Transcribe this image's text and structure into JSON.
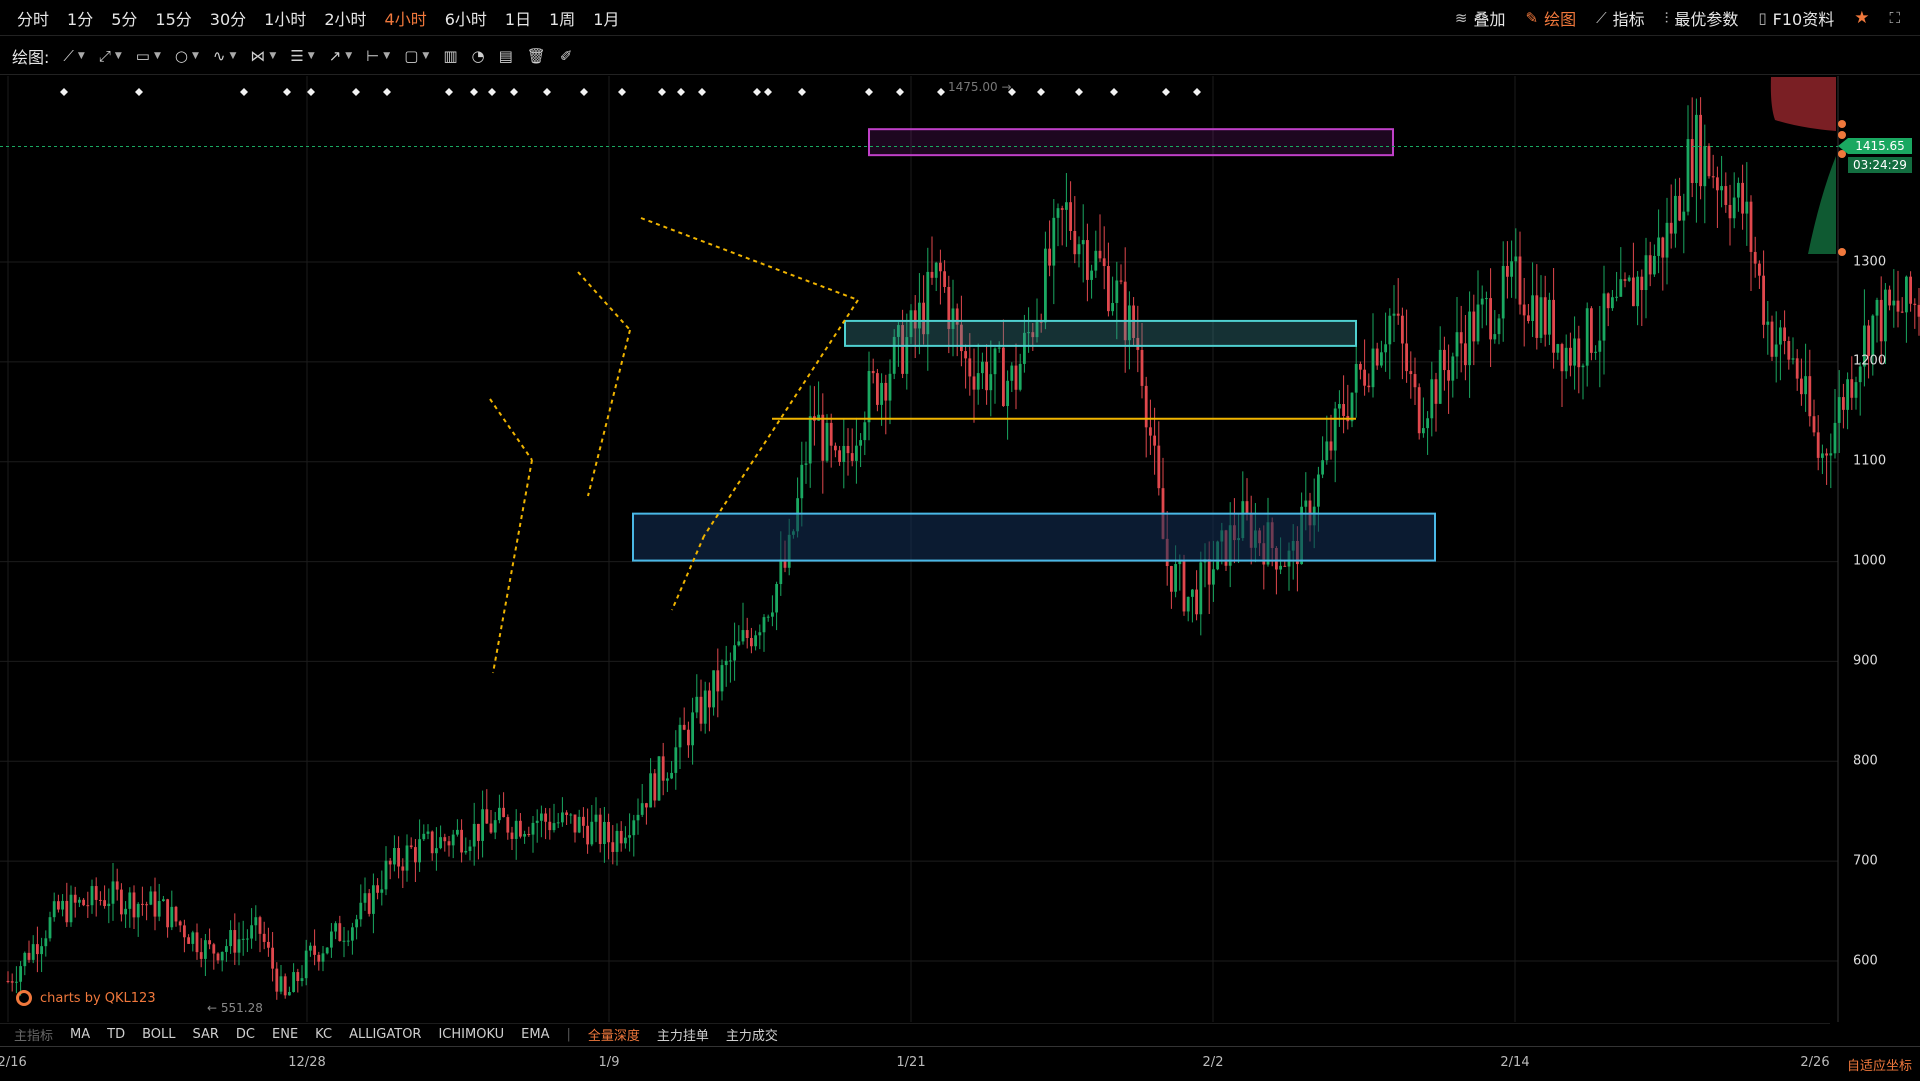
{
  "timeframes": [
    {
      "label": "分时",
      "active": false
    },
    {
      "label": "1分",
      "active": false
    },
    {
      "label": "5分",
      "active": false
    },
    {
      "label": "15分",
      "active": false
    },
    {
      "label": "30分",
      "active": false
    },
    {
      "label": "1小时",
      "active": false
    },
    {
      "label": "2小时",
      "active": false
    },
    {
      "label": "4小时",
      "active": true
    },
    {
      "label": "6小时",
      "active": false
    },
    {
      "label": "1日",
      "active": false
    },
    {
      "label": "1周",
      "active": false
    },
    {
      "label": "1月",
      "active": false
    }
  ],
  "right_tools": {
    "overlay": "叠加",
    "draw": "绘图",
    "indicators": "指标",
    "best_params": "最优参数",
    "f10": "F10资料"
  },
  "draw_toolbar": {
    "label": "绘图:"
  },
  "indicator_bar": {
    "main_indicator": "主指标",
    "items": [
      "MA",
      "TD",
      "BOLL",
      "SAR",
      "DC",
      "ENE",
      "KC",
      "ALLIGATOR",
      "ICHIMOKU",
      "EMA"
    ],
    "depth_items": [
      "全量深度",
      "主力挂单",
      "主力成交"
    ]
  },
  "dates": [
    "12/16",
    "12/28",
    "1/9",
    "1/21",
    "2/2",
    "2/14",
    "2/26"
  ],
  "autoscale_label": "自适应坐标",
  "yaxis": [
    "1300",
    "1200",
    "1100",
    "1000",
    "900",
    "800",
    "700",
    "600"
  ],
  "current_price": "1415.65",
  "countdown": "03:24:29",
  "max_label": "1475.00",
  "min_label": "551.28",
  "brand": "charts by QKL123",
  "colors": {
    "up": "#1aa861",
    "down": "#e0484d",
    "accent": "#f0783c",
    "grid": "#1c1c1c",
    "zone_purple": "#c040c8",
    "zone_teal": "#4fd0d0",
    "zone_blue": "#4ab8e6",
    "trend_dots": "#f0b400"
  },
  "chart_data": {
    "type": "candlestick",
    "title": "",
    "xlabel": "",
    "ylabel": "",
    "ylim": [
      510,
      1555
    ],
    "x_ticks": [
      "12/16",
      "12/28",
      "1/9",
      "1/21",
      "2/2",
      "2/14",
      "2/26"
    ],
    "y_ticks": [
      600,
      700,
      800,
      900,
      1000,
      1100,
      1200,
      1300
    ],
    "current_price": 1415.65,
    "high_marker": 1475.0,
    "low_marker": 551.28,
    "price_path": [
      [
        12.16,
        580
      ],
      [
        12.18,
        650
      ],
      [
        12.2,
        665
      ],
      [
        12.22,
        655
      ],
      [
        12.24,
        610
      ],
      [
        12.26,
        630
      ],
      [
        12.27,
        560
      ],
      [
        12.28,
        605
      ],
      [
        12.3,
        645
      ],
      [
        12.31,
        690
      ],
      [
        13.01,
        710
      ],
      [
        13.04,
        735
      ],
      [
        13.06,
        742
      ],
      [
        13.08,
        735
      ],
      [
        13.09,
        720
      ],
      [
        13.11,
        790
      ],
      [
        13.13,
        870
      ],
      [
        13.15,
        950
      ],
      [
        13.16,
        1000
      ],
      [
        13.17,
        1150
      ],
      [
        13.18,
        1080
      ],
      [
        13.19,
        1160
      ],
      [
        13.21,
        1230
      ],
      [
        13.22,
        1290
      ],
      [
        13.23,
        1200
      ],
      [
        13.25,
        1180
      ],
      [
        13.27,
        1350
      ],
      [
        13.29,
        1270
      ],
      [
        13.3,
        1210
      ],
      [
        13.31,
        1000
      ],
      [
        14.01,
        960
      ],
      [
        14.03,
        1040
      ],
      [
        14.05,
        1000
      ],
      [
        14.07,
        1150
      ],
      [
        14.09,
        1250
      ],
      [
        14.1,
        1150
      ],
      [
        14.12,
        1230
      ],
      [
        14.14,
        1280
      ],
      [
        14.16,
        1210
      ],
      [
        14.18,
        1250
      ],
      [
        14.2,
        1330
      ],
      [
        14.21,
        1420
      ],
      [
        14.23,
        1350
      ],
      [
        14.24,
        1230
      ],
      [
        14.25,
        1200
      ],
      [
        14.26,
        1100
      ],
      [
        14.27,
        1170
      ],
      [
        14.28,
        1240
      ],
      [
        14.3,
        1260
      ],
      [
        14.31,
        1370
      ],
      [
        15.01,
        1445
      ],
      [
        15.02,
        1340
      ],
      [
        15.03,
        1290
      ],
      [
        15.04,
        1380
      ],
      [
        15.05,
        1300
      ],
      [
        15.06,
        1240
      ],
      [
        15.07,
        1320
      ],
      [
        15.08,
        1400
      ],
      [
        15.09,
        1320
      ],
      [
        15.1,
        1360
      ],
      [
        15.11,
        1300
      ],
      [
        15.12,
        1330
      ],
      [
        15.13,
        1415
      ]
    ],
    "zones": [
      {
        "name": "resistance",
        "from": 1407,
        "to": 1433
      },
      {
        "name": "mid-support",
        "from": 1216,
        "to": 1241
      },
      {
        "name": "support",
        "from": 1001,
        "to": 1048
      }
    ],
    "horizontal_lines": [
      {
        "price": 1143
      }
    ]
  }
}
